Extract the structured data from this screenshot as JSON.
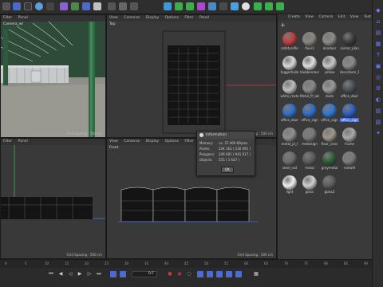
{
  "viewport_menu": [
    "View",
    "Cameras",
    "Display",
    "Options",
    "Filter",
    "Panel"
  ],
  "viewport_menu_short": [
    "Filter",
    "Panel"
  ],
  "viewports": {
    "perspective": {
      "label": "Camera_wl",
      "grid": "Grid Spacing : 500 cm"
    },
    "top": {
      "label": "Top",
      "grid": "Grid Spacing : 500 cm"
    },
    "right": {
      "label": "",
      "grid": "Grid Spacing : 500 cm"
    },
    "front": {
      "label": "Front",
      "grid": "Grid Spacing : 500 cm"
    }
  },
  "material_menu": [
    "Create",
    "View",
    "Camera",
    "Edit",
    "View",
    "Text"
  ],
  "materials": [
    {
      "name": "safetyrefle",
      "color": "#c23c3c"
    },
    {
      "name": "floor2",
      "color": "#8a8780"
    },
    {
      "name": "doodoor",
      "color": "#8d8b86"
    },
    {
      "name": "corner_plan",
      "color": "#3b3b3b"
    },
    {
      "name": "fuggerhalle",
      "color": "#d8d8d8"
    },
    {
      "name": "blubbendun",
      "color": "#e0e0e0"
    },
    {
      "name": "yellow",
      "color": "#c8c8c8"
    },
    {
      "name": "decorbum_1",
      "color": "#8a8a8a"
    },
    {
      "name": "white_mate",
      "color": "#bdbdbd"
    },
    {
      "name": "Metal_Pl_ale",
      "color": "#8a8a8a"
    },
    {
      "name": "dude",
      "color": "#9a9a9a"
    },
    {
      "name": "office_door",
      "color": "#4b4f55"
    },
    {
      "name": "office_door",
      "color": "#2e6fc9"
    },
    {
      "name": "office_sign",
      "color": "#2f6dc7"
    },
    {
      "name": "office_sign",
      "color": "#2e78d2"
    },
    {
      "name": "office_sign",
      "color": "#2a5fbf"
    },
    {
      "name": "metal_pl_t",
      "color": "#8f8f8f"
    },
    {
      "name": "metalsign",
      "color": "#7a7a7a"
    },
    {
      "name": "floor_conc",
      "color": "#9c968c"
    },
    {
      "name": "frame",
      "color": "#a9a9a9"
    },
    {
      "name": "steel_rod",
      "color": "#6c6c6c"
    },
    {
      "name": "metal",
      "color": "#5b5b5b"
    },
    {
      "name": "greymetal",
      "color": "#2d5e3a"
    },
    {
      "name": "metal9",
      "color": "#7a7a7a"
    },
    {
      "name": "light",
      "color": "#f0f0f0"
    },
    {
      "name": "glass",
      "color": "#d0d0d0"
    },
    {
      "name": "glass2",
      "color": "#5c5c5c"
    }
  ],
  "dialog": {
    "title": "Information",
    "rows": [
      {
        "k": "Memory:",
        "v": "ca. 37.469 KBytes"
      },
      {
        "k": "Points:",
        "v": "234 163 ( 530 091 )"
      },
      {
        "k": "Polygons:",
        "v": "246 081 ( 941 017 )"
      },
      {
        "k": "Objects:",
        "v": "555 ( 1 647 )"
      }
    ],
    "ok": "OK"
  },
  "ruler_ticks": [
    "0",
    "5",
    "10",
    "15",
    "20",
    "25",
    "30",
    "35",
    "40",
    "45",
    "50",
    "55",
    "60",
    "65",
    "70",
    "75",
    "80",
    "85",
    "90"
  ],
  "frame_field": "0 F",
  "colors": {
    "accent": "#4c6bd1",
    "axis_red": "#d03a3a",
    "axis_green": "#3fae3f"
  }
}
